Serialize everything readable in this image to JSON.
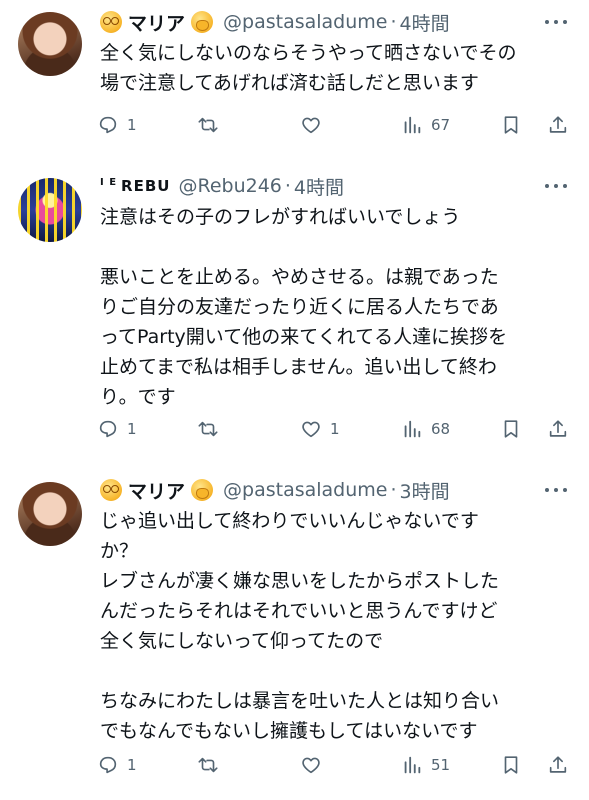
{
  "tweets": [
    {
      "name": "マリア",
      "handle": "@pastasaladume",
      "separator": "·",
      "time": "4時間",
      "body": "全く気にしないのならそうやって晒さないでその\n場で注意してあげれば済む話しだと思います",
      "replies": "1",
      "retweets": "",
      "likes": "",
      "views": "67"
    },
    {
      "name_prefix": "I E",
      "name": "REBU",
      "handle": "@Rebu246",
      "separator": "·",
      "time": "4時間",
      "body": "注意はその子のフレがすればいいでしょう\n\n悪いことを止める。やめさせる。は親であった\nりご自分の友達だったり近くに居る人たちであ\nってParty開いて他の来てくれてる人達に挨拶を\n止めてまで私は相手しません。追い出して終わ\nり。です",
      "replies": "1",
      "retweets": "",
      "likes": "1",
      "views": "68"
    },
    {
      "name": "マリア",
      "handle": "@pastasaladume",
      "separator": "·",
      "time": "3時間",
      "body": "じゃ追い出して終わりでいいんじゃないです\nか？\nレブさんが凄く嫌な思いをしたからポストした\nんだったらそれはそれでいいと思うんですけど\n全く気にしないって仰ってたので\n\nちなみにわたしは暴言を吐いた人とは知り合い\nでもなんでもないし擁護もしてはいないです",
      "replies": "1",
      "retweets": "",
      "likes": "",
      "views": "51"
    }
  ],
  "icons": {
    "reply": "reply-icon",
    "retweet": "retweet-icon",
    "like": "like-icon",
    "views": "views-icon",
    "bookmark": "bookmark-icon",
    "share": "share-icon"
  },
  "colors": {
    "text": "#0f1419",
    "muted": "#536471",
    "background": "#ffffff"
  }
}
